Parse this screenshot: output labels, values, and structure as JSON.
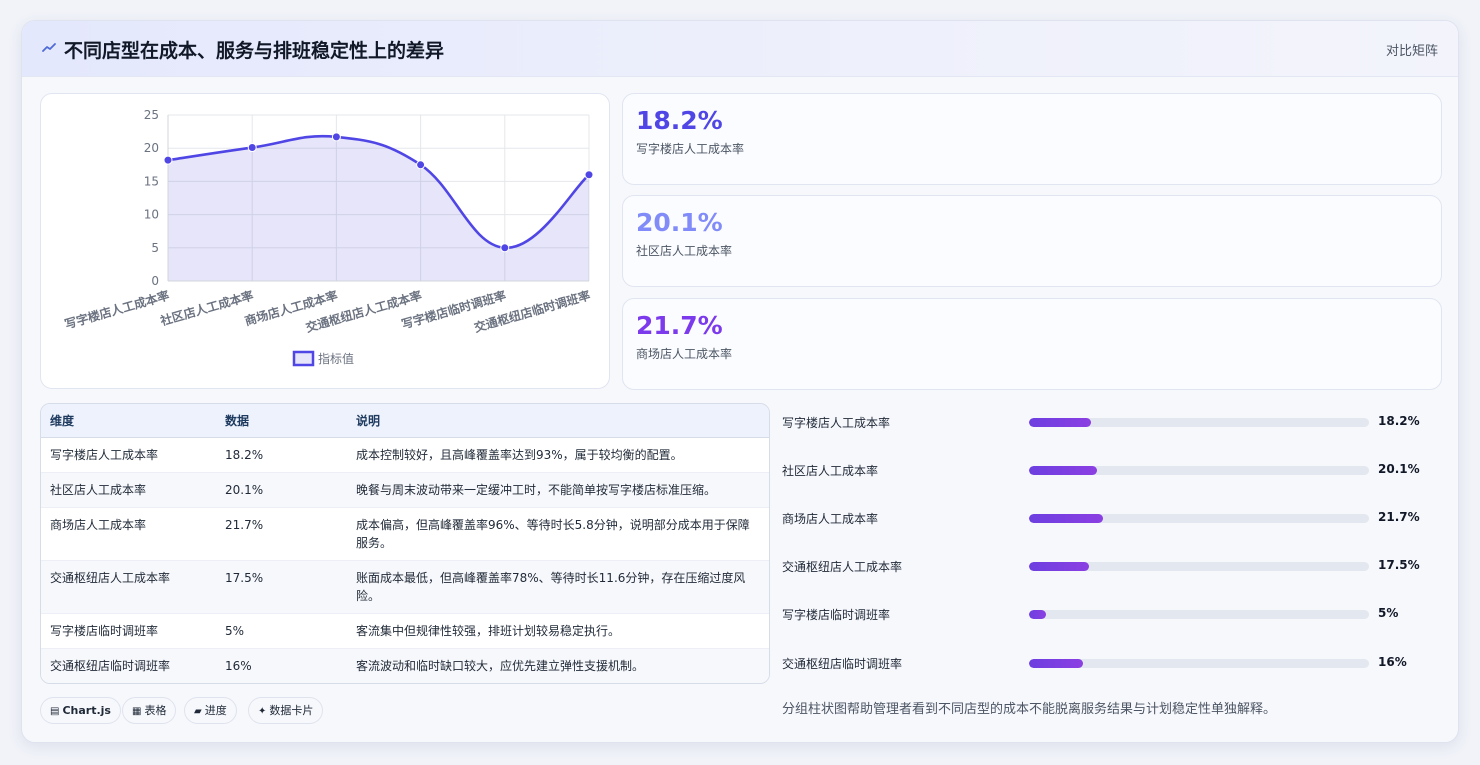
{
  "header": {
    "icon": "trend-line-icon",
    "title": "不同店型在成本、服务与排班稳定性上的差异",
    "tag": "对比矩阵"
  },
  "chart_data": {
    "type": "line",
    "categories": [
      "写字楼店人工成本率",
      "社区店人工成本率",
      "商场店人工成本率",
      "交通枢纽店人工成本率",
      "写字楼店临时调班率",
      "交通枢纽店临时调班率"
    ],
    "series": [
      {
        "name": "指标值",
        "values": [
          18.2,
          20.1,
          21.7,
          17.5,
          5,
          16
        ]
      }
    ],
    "yticks": [
      "0",
      "5",
      "10",
      "15",
      "20",
      "25"
    ],
    "ylim": [
      0,
      25
    ],
    "grid": true,
    "area_fill": true,
    "legend_position": "bottom",
    "color": "#4f46e5"
  },
  "kpis": [
    {
      "value": "18.2%",
      "label": "写字楼店人工成本率",
      "color": "#4f46e5"
    },
    {
      "value": "20.1%",
      "label": "社区店人工成本率",
      "color": "#818cf8"
    },
    {
      "value": "21.7%",
      "label": "商场店人工成本率",
      "color": "#7c3aed"
    }
  ],
  "table": {
    "headers": [
      "维度",
      "数据",
      "说明"
    ],
    "rows": [
      [
        "写字楼店人工成本率",
        "18.2%",
        "成本控制较好，且高峰覆盖率达到93%，属于较均衡的配置。"
      ],
      [
        "社区店人工成本率",
        "20.1%",
        "晚餐与周末波动带来一定缓冲工时，不能简单按写字楼店标准压缩。"
      ],
      [
        "商场店人工成本率",
        "21.7%",
        "成本偏高，但高峰覆盖率96%、等待时长5.8分钟，说明部分成本用于保障服务。"
      ],
      [
        "交通枢纽店人工成本率",
        "17.5%",
        "账面成本最低，但高峰覆盖率78%、等待时长11.6分钟，存在压缩过度风险。"
      ],
      [
        "写字楼店临时调班率",
        "5%",
        "客流集中但规律性较强，排班计划较易稳定执行。"
      ],
      [
        "交通枢纽店临时调班率",
        "16%",
        "客流波动和临时缺口较大，应优先建立弹性支援机制。"
      ]
    ]
  },
  "progress": {
    "max": 100,
    "items": [
      {
        "label": "写字楼店人工成本率",
        "value": 18.2,
        "display": "18.2%"
      },
      {
        "label": "社区店人工成本率",
        "value": 20.1,
        "display": "20.1%"
      },
      {
        "label": "商场店人工成本率",
        "value": 21.7,
        "display": "21.7%"
      },
      {
        "label": "交通枢纽店人工成本率",
        "value": 17.5,
        "display": "17.5%"
      },
      {
        "label": "写字楼店临时调班率",
        "value": 5,
        "display": "5%"
      },
      {
        "label": "交通枢纽店临时调班率",
        "value": 16,
        "display": "16%"
      }
    ]
  },
  "note": "分组柱状图帮助管理者看到不同店型的成本不能脱离服务结果与计划稳定性单独解释。",
  "chips": [
    {
      "icon": "chart-icon",
      "label": "Chart.js"
    },
    {
      "icon": "table-icon",
      "label": "表格"
    },
    {
      "icon": "progress-icon",
      "label": "进度"
    },
    {
      "icon": "sparkle-icon",
      "label": "数据卡片"
    }
  ]
}
